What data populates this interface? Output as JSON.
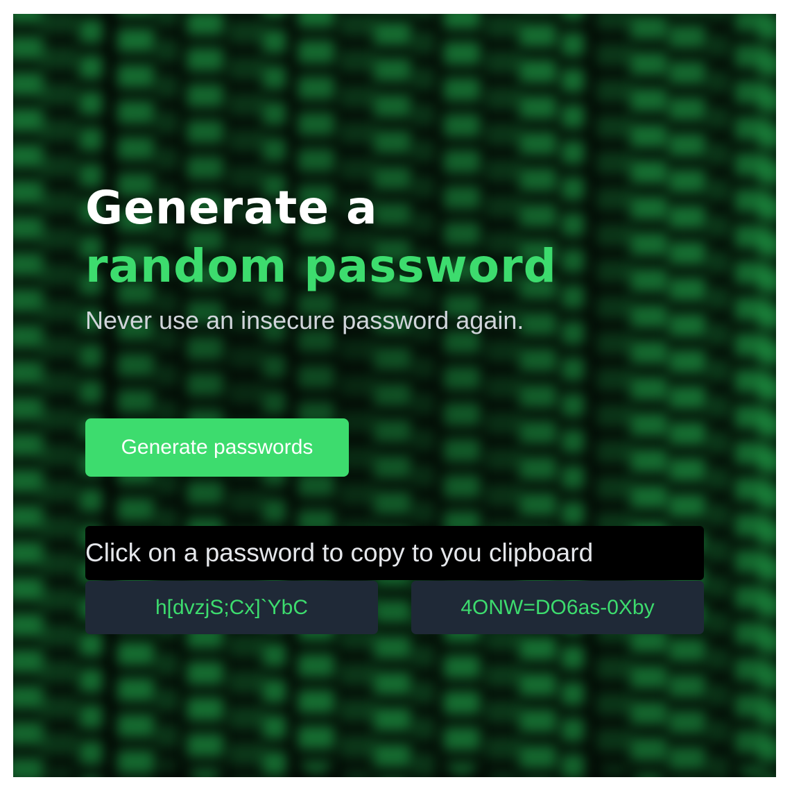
{
  "hero": {
    "title_line1": "Generate a",
    "title_line2": "random password",
    "subtitle": "Never use an insecure password again."
  },
  "actions": {
    "generate_label": "Generate passwords"
  },
  "hint": {
    "text": "Click on a password to copy to you clipboard"
  },
  "passwords": [
    "h[dvzjS;Cx]`YbC",
    "4ONW=DO6as-0Xby"
  ],
  "colors": {
    "accent": "#3ddc6e",
    "password_box_bg": "#1f2937",
    "hint_bg": "#000000",
    "title": "#ffffff",
    "subtitle": "#d1d5db"
  },
  "background": {
    "style": "blurred green matrix code rain"
  }
}
